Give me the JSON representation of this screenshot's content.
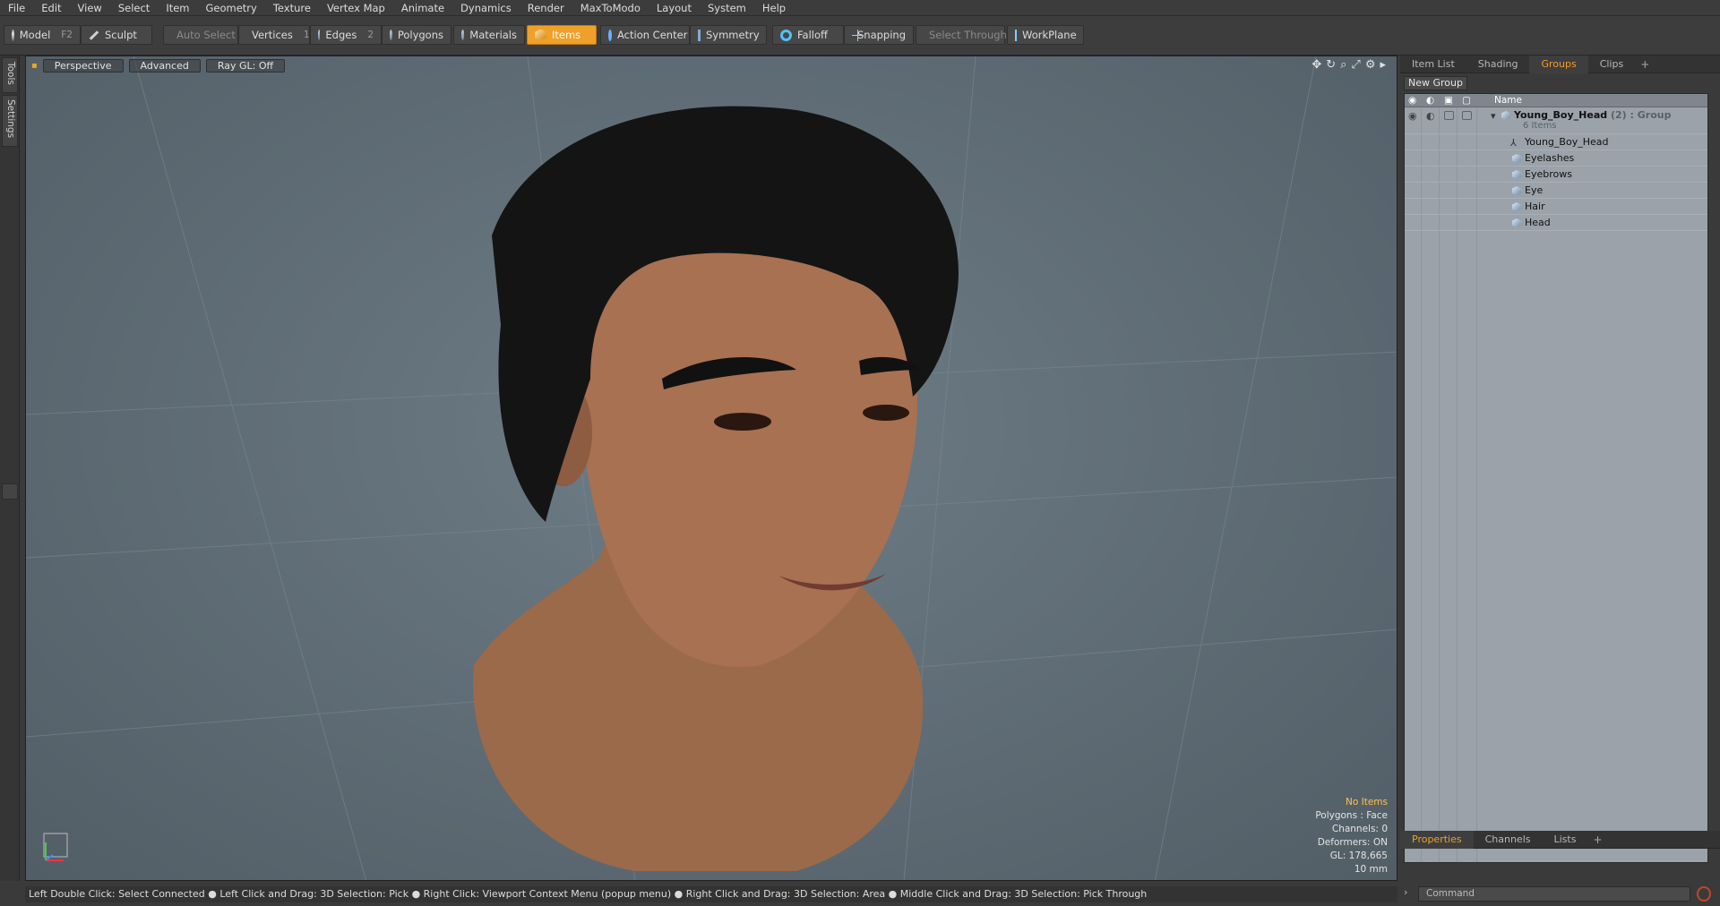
{
  "menu": [
    "File",
    "Edit",
    "View",
    "Select",
    "Item",
    "Geometry",
    "Texture",
    "Vertex Map",
    "Animate",
    "Dynamics",
    "Render",
    "MaxToModo",
    "Layout",
    "System",
    "Help"
  ],
  "toolbar": {
    "model": "Model",
    "model_key": "F2",
    "sculpt": "Sculpt",
    "auto_select": "Auto Select",
    "vertices": "Vertices",
    "vertices_key": "1",
    "edges": "Edges",
    "edges_key": "2",
    "polygons": "Polygons",
    "materials": "Materials",
    "items": "Items",
    "action_center": "Action Center",
    "symmetry": "Symmetry",
    "falloff": "Falloff",
    "snapping": "Snapping",
    "select_through": "Select Through",
    "workplane": "WorkPlane"
  },
  "left_tabs": [
    "Tools",
    "Settings"
  ],
  "viewport": {
    "perspective": "Perspective",
    "advanced": "Advanced",
    "raygl": "Ray GL: Off",
    "stats": {
      "no_items": "No Items",
      "polygons": "Polygons : Face",
      "channels": "Channels: 0",
      "deformers": "Deformers: ON",
      "gl": "GL: 178,665",
      "scale": "10 mm"
    }
  },
  "panel_tabs": [
    "Item List",
    "Shading",
    "Groups",
    "Clips"
  ],
  "panel_tabs_active": "Groups",
  "new_group": "New Group",
  "tree": {
    "name_header": "Name",
    "group": {
      "name": "Young_Boy_Head",
      "count": "(2)",
      "type": ": Group",
      "items": "6 Items"
    },
    "children": [
      "Young_Boy_Head",
      "Eyelashes",
      "Eyebrows",
      "Eye",
      "Hair",
      "Head"
    ]
  },
  "bottom_tabs": [
    "Properties",
    "Channels",
    "Lists"
  ],
  "bottom_tabs_active": "Properties",
  "status": "Left Double Click: Select Connected ● Left Click and Drag: 3D Selection: Pick ● Right Click: Viewport Context Menu (popup menu) ● Right Click and Drag: 3D Selection: Area ● Middle Click and Drag: 3D Selection: Pick Through",
  "command_placeholder": "Command"
}
